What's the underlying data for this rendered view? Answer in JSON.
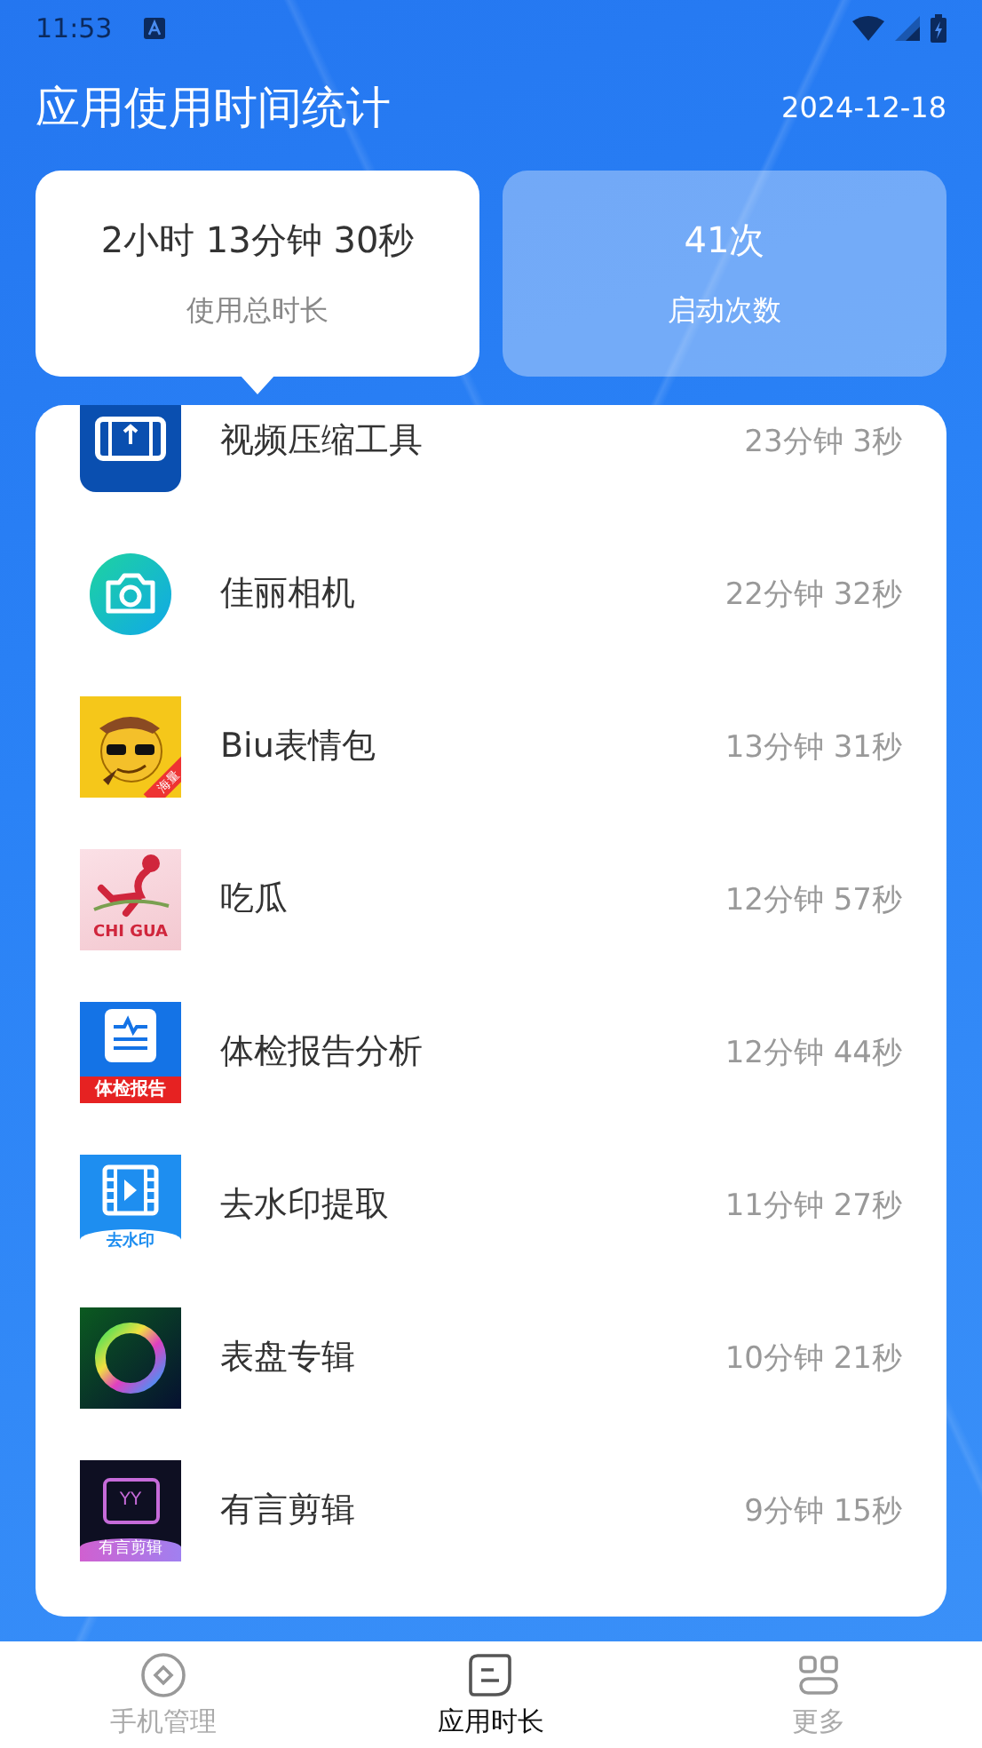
{
  "status_bar": {
    "time": "11:53"
  },
  "header": {
    "title": "应用使用时间统计",
    "date": "2024-12-18"
  },
  "stats": [
    {
      "value": "2小时 13分钟 30秒",
      "label": "使用总时长",
      "selected": true
    },
    {
      "value": "41次",
      "label": "启动次数",
      "selected": false
    }
  ],
  "apps": [
    {
      "name": "视频压缩工具",
      "duration": "23分钟 3秒",
      "kind": "compress"
    },
    {
      "name": "佳丽相机",
      "duration": "22分钟 32秒",
      "kind": "camera"
    },
    {
      "name": "Biu表情包",
      "duration": "13分钟 31秒",
      "kind": "emoji",
      "icon_text": "海量"
    },
    {
      "name": "吃瓜",
      "duration": "12分钟 57秒",
      "kind": "figure",
      "icon_text": "CHI GUA"
    },
    {
      "name": "体检报告分析",
      "duration": "12分钟 44秒",
      "kind": "report",
      "icon_text": "体检报告"
    },
    {
      "name": "去水印提取",
      "duration": "11分钟 27秒",
      "kind": "film",
      "icon_text": "去水印"
    },
    {
      "name": "表盘专辑",
      "duration": "10分钟 21秒",
      "kind": "ring"
    },
    {
      "name": "有言剪辑",
      "duration": "9分钟 15秒",
      "kind": "yy",
      "icon_text": "有言剪辑",
      "icon_text_2": "YY"
    }
  ],
  "bottom_nav": [
    {
      "label": "手机管理",
      "kind": "diamond",
      "selected": false
    },
    {
      "label": "应用时长",
      "kind": "note",
      "selected": true
    },
    {
      "label": "更多",
      "kind": "more",
      "selected": false
    }
  ]
}
